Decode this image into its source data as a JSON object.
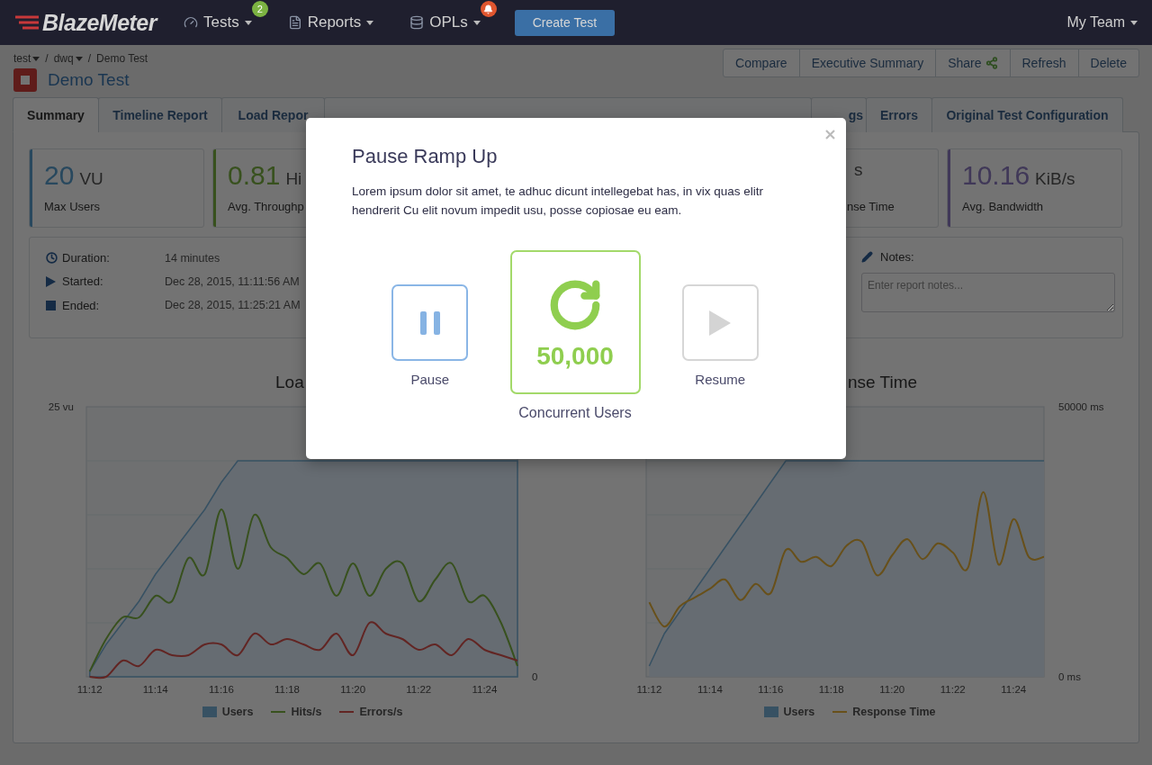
{
  "nav": {
    "logo": "BlazeMeter",
    "items": [
      {
        "label": "Tests",
        "kind": "gauge",
        "badge": "2",
        "color": "#7cb342"
      },
      {
        "label": "Reports",
        "kind": "file"
      },
      {
        "label": "OPLs",
        "kind": "database",
        "color": "#e0562f"
      }
    ],
    "create_button": "Create Test",
    "team": "My Team"
  },
  "breadcrumb": [
    {
      "label": "test",
      "dropdown": true
    },
    {
      "separator": "/",
      "label": "dwq",
      "dropdown": true
    },
    {
      "separator": "/",
      "label": "Demo Test",
      "dropdown": false
    }
  ],
  "title": "Demo Test",
  "actions": [
    {
      "label": "Compare",
      "kind": "plain"
    },
    {
      "label": "Executive Summary",
      "kind": "plain"
    },
    {
      "label": "Share",
      "kind": "share"
    },
    {
      "label": "Refresh",
      "kind": "plain"
    },
    {
      "label": "Delete",
      "kind": "plain"
    }
  ],
  "tabs": [
    {
      "label": "Summary",
      "selected": true
    },
    {
      "label": "Timeline Report",
      "selected": false
    },
    {
      "label": "Load Repor",
      "selected": false
    },
    {
      "label": "gs",
      "selected": false
    },
    {
      "label": "Errors",
      "selected": false
    },
    {
      "label": "Original Test Configuration",
      "selected": false
    }
  ],
  "stats": [
    {
      "value": "20",
      "unit": "VU",
      "label": "Max Users",
      "color": "#28485e"
    },
    {
      "value": "0.81",
      "unit": "Hi",
      "label": "Avg. Throughp",
      "color": "#38511e"
    },
    {
      "unit": "s",
      "label": "nse Time"
    },
    {
      "value": "10.16",
      "unit": "KiB/s",
      "label": "Avg. Bandwidth",
      "color": "#403858"
    }
  ],
  "details": [
    {
      "kind": "clock",
      "label": "Duration:",
      "value": "14 minutes"
    },
    {
      "kind": "play",
      "label": "Started:",
      "value": "Dec 28, 2015, 11:11:56 AM"
    },
    {
      "kind": "stop",
      "label": "Ended:",
      "value": "Dec 28, 2015, 11:25:21 AM"
    }
  ],
  "notes": {
    "label": "Notes:",
    "placeholder": "Enter report notes..."
  },
  "charts": [
    {
      "title": "Loa",
      "axis_labels": [
        "25 vu",
        "0"
      ],
      "x_labels": [
        "11:12",
        "11:14",
        "11:16",
        "11:18",
        "11:20",
        "11:22",
        "11:24"
      ],
      "legend": [
        {
          "name": "Users",
          "color": "#375163"
        },
        {
          "name": "Hits/s",
          "color": "#38511e"
        },
        {
          "name": "Errors/s",
          "color": "#622523"
        }
      ]
    },
    {
      "chart_data": {
        "type": "line",
        "title": "nse Time",
        "ylim": [
          0,
          50000
        ],
        "legend": "bottom",
        "categories": [
          "11:12",
          null,
          null,
          null,
          "11:14",
          null,
          null,
          null,
          "11:16",
          null,
          null,
          null,
          "11:18",
          null,
          null,
          null,
          "11:20",
          null,
          null,
          null,
          "11:22",
          null,
          null,
          null,
          "11:24",
          null,
          null
        ],
        "yticks": [
          {
            "value": 50000,
            "label": "50000 ms"
          },
          {
            "value": 0,
            "label": "0 ms"
          }
        ],
        "series": [
          {
            "name": "Users",
            "color": "#375163",
            "values": [
              2000,
              8000,
              12000,
              16000,
              20000,
              24000,
              28000,
              32000,
              36000,
              40000,
              40000,
              40000,
              40000,
              40000,
              40000,
              40000,
              40000,
              40000,
              40000,
              40000,
              40000,
              40000,
              40000,
              40000,
              40000,
              40000,
              40000
            ]
          },
          {
            "name": "Response Time",
            "color": "#68501a",
            "values": [
              13800,
              9300,
              13000,
              14700,
              16300,
              18000,
              14200,
              17200,
              15500,
              23500,
              21300,
              22200,
              20500,
              24300,
              25000,
              18800,
              22500,
              25500,
              21800,
              24700,
              23000,
              20200,
              34200,
              20800,
              29200,
              22200,
              22200
            ]
          }
        ]
      }
    }
  ],
  "modal": {
    "title": "Pause Ramp Up",
    "text": "Lorem ipsum dolor sit amet, te adhuc dicunt intellegebat has, in vix quas elitr hendrerit  Cu elit novum impedit usu, posse copiosae eu eam.",
    "controls": [
      {
        "kind": "pause",
        "label": "Pause",
        "disabled": false
      },
      {
        "kind": "counter",
        "value": "50,000",
        "label": "Concurrent Users"
      },
      {
        "kind": "resume",
        "label": "Resume",
        "disabled": true
      }
    ]
  }
}
